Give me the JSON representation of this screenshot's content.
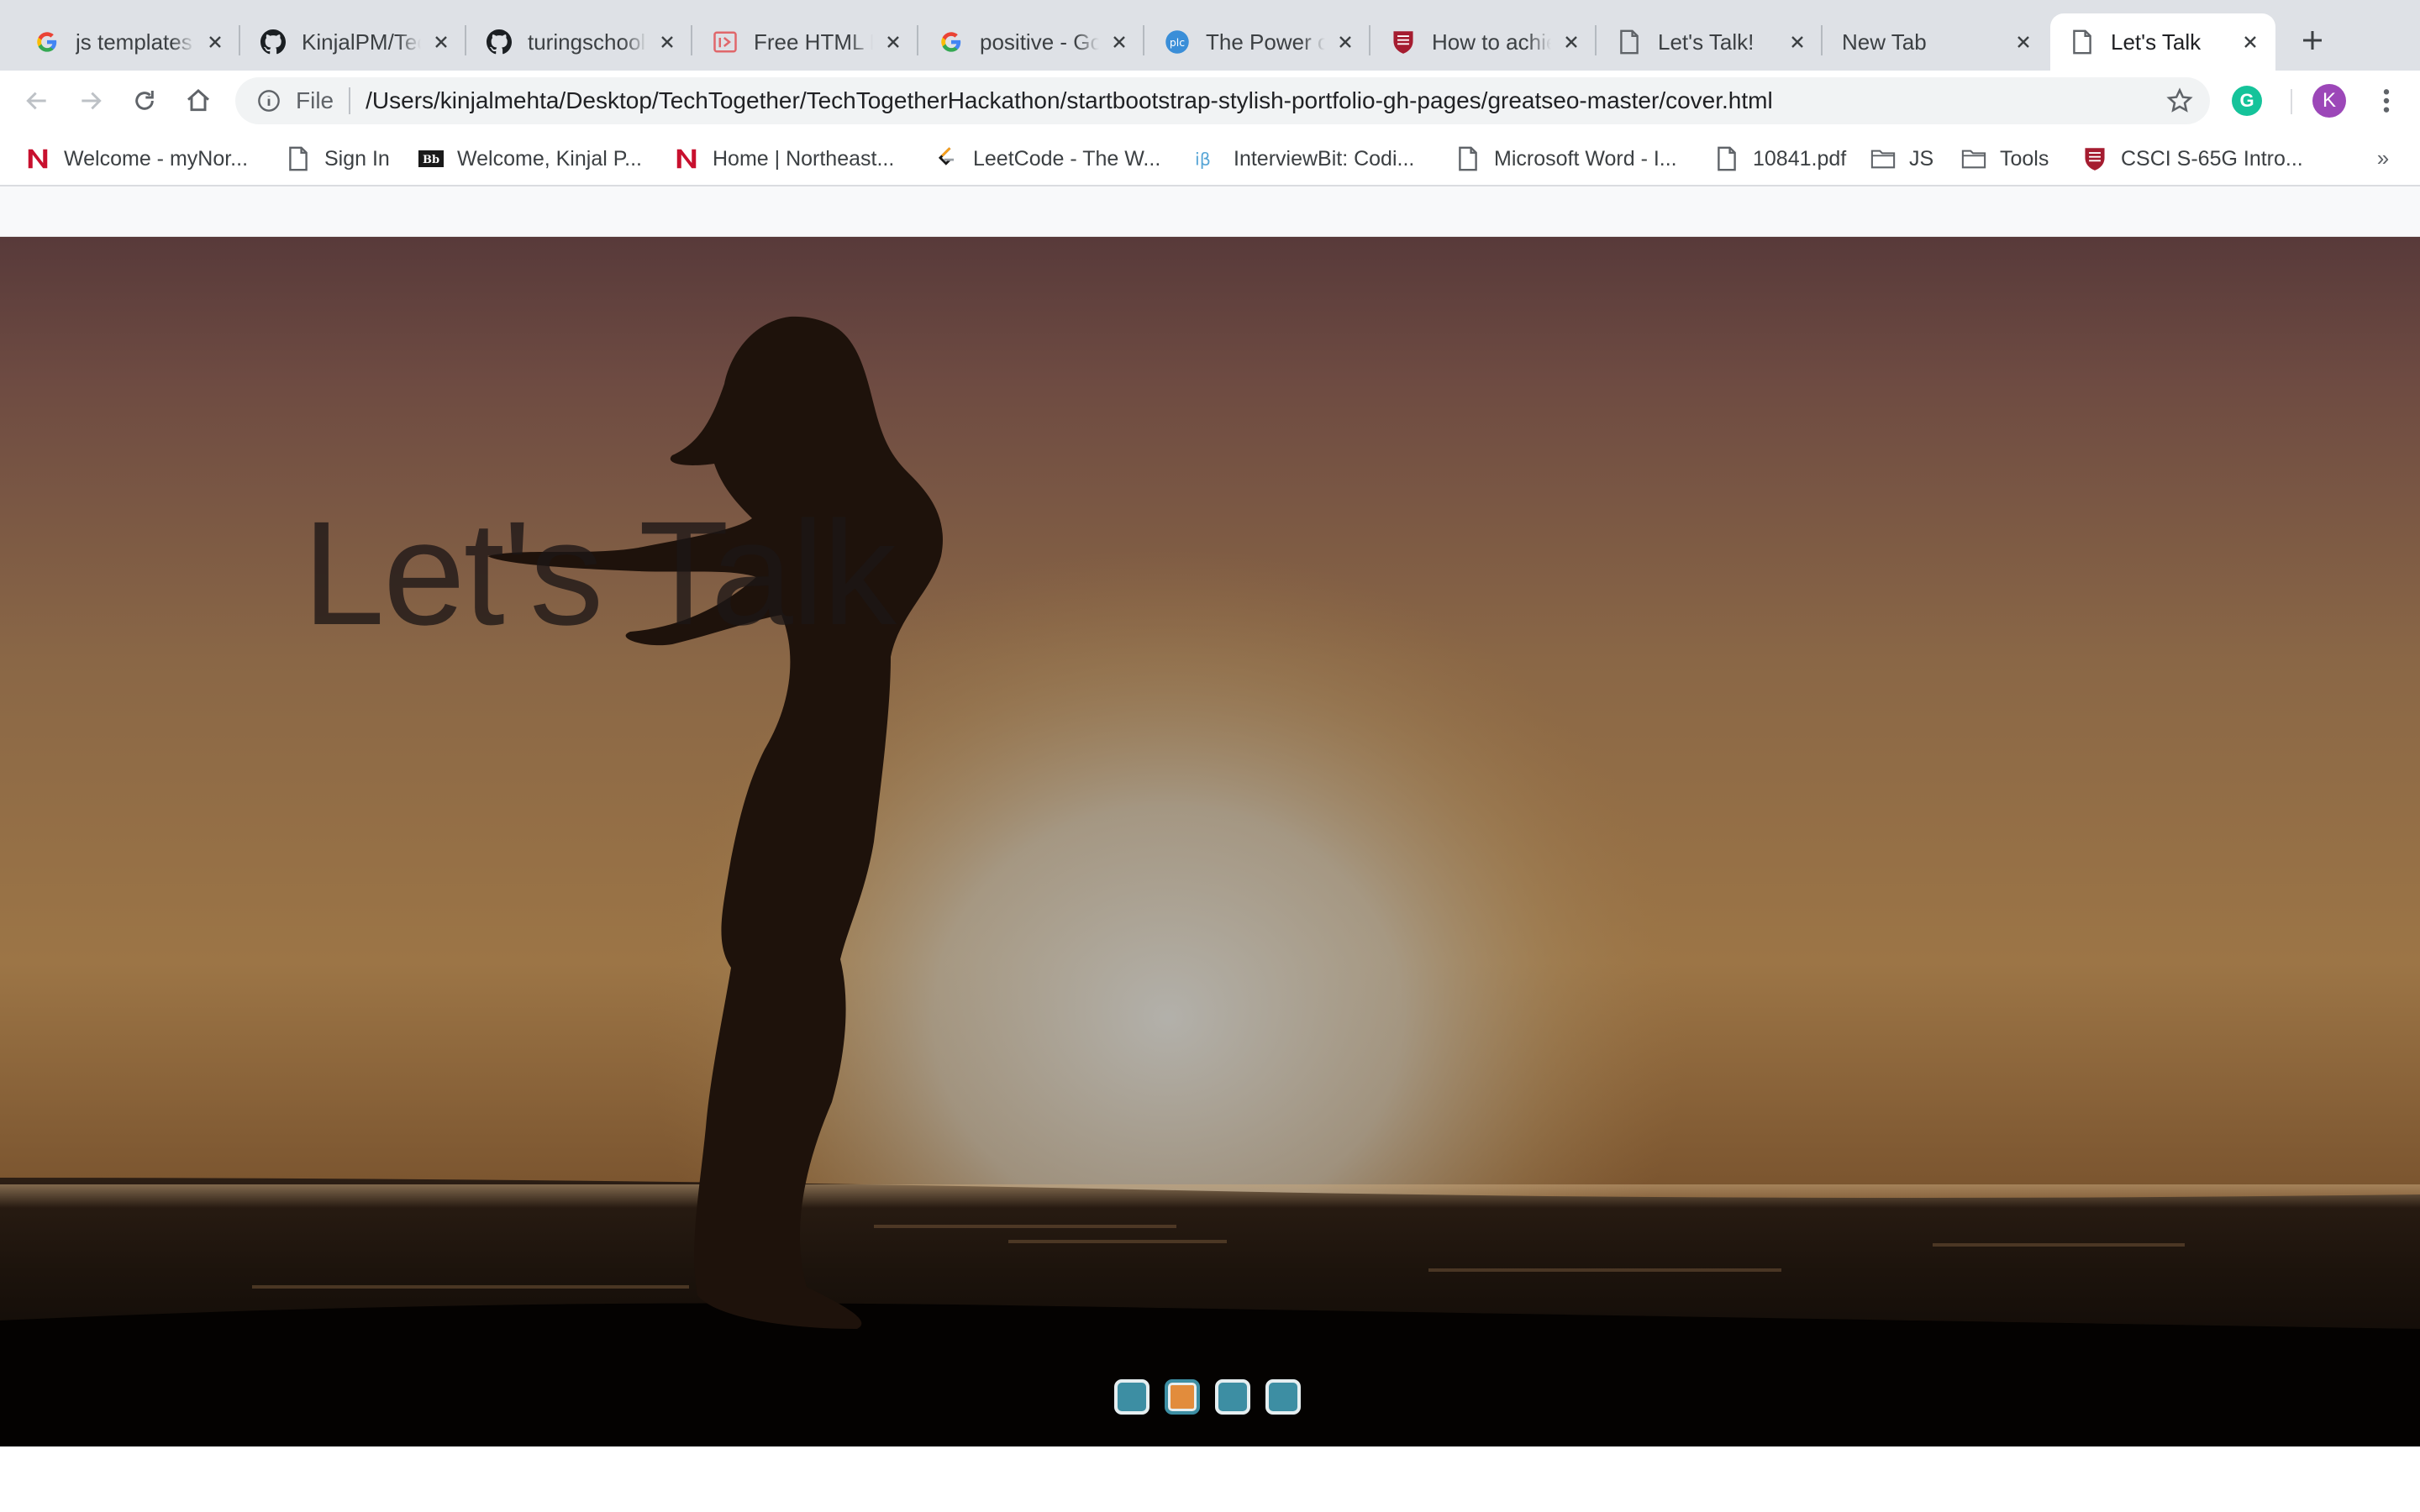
{
  "browser": {
    "tabs": [
      {
        "title": "js templates",
        "favicon": "google-icon"
      },
      {
        "title": "KinjalPM/TechTogether",
        "favicon": "github-icon"
      },
      {
        "title": "turingschool",
        "favicon": "github-icon"
      },
      {
        "title": "Free HTML Bootstrap",
        "favicon": "template-icon"
      },
      {
        "title": "positive - Google Search",
        "favicon": "google-icon"
      },
      {
        "title": "The Power of Positive",
        "favicon": "globe-icon"
      },
      {
        "title": "How to achieve",
        "favicon": "shield-icon"
      },
      {
        "title": "Let's Talk!",
        "favicon": "page-icon"
      },
      {
        "title": "New Tab",
        "favicon": "none"
      },
      {
        "title": "Let's Talk",
        "favicon": "page-icon",
        "active": true
      }
    ],
    "omnibox": {
      "scheme": "File",
      "url": "/Users/kinjalmehta/Desktop/TechTogether/TechTogetherHackathon/startbootstrap-stylish-portfolio-gh-pages/greatseo-master/cover.html"
    },
    "profile_initial": "K",
    "extension_letter": "G",
    "bookmarks": [
      {
        "label": "Welcome - myNor...",
        "icon": "northeastern-icon"
      },
      {
        "label": "Sign In",
        "icon": "page-icon"
      },
      {
        "label": "Welcome, Kinjal P...",
        "icon": "blackboard-icon"
      },
      {
        "label": "Home | Northeast...",
        "icon": "northeastern-icon"
      },
      {
        "label": "LeetCode - The W...",
        "icon": "leetcode-icon"
      },
      {
        "label": "InterviewBit: Codi...",
        "icon": "interviewbit-icon"
      },
      {
        "label": "Microsoft Word - I...",
        "icon": "page-icon"
      },
      {
        "label": "10841.pdf",
        "icon": "page-icon"
      },
      {
        "label": "JS",
        "icon": "folder-icon"
      },
      {
        "label": "Tools",
        "icon": "folder-icon"
      },
      {
        "label": "CSCI S-65G Intro...",
        "icon": "harvard-icon"
      }
    ],
    "bookmarks_overflow": "»"
  },
  "page": {
    "hero_heading": "Let's Talk",
    "carousel": {
      "slide_count": 4,
      "active_index": 1
    }
  },
  "colors": {
    "indicator": "#3d8ea3",
    "indicator_active": "#e28c3c",
    "profile": "#9c47b8",
    "extension": "#15c39a"
  }
}
